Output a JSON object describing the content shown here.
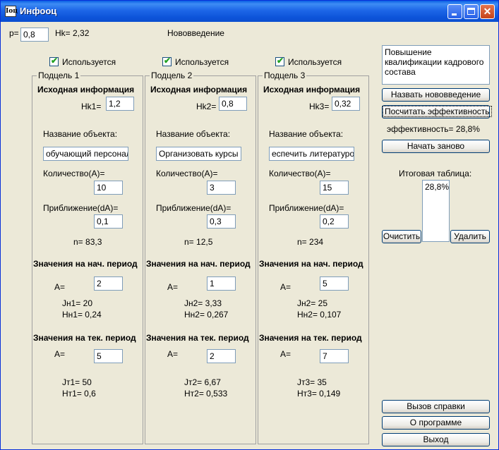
{
  "window": {
    "title": "Инфооц",
    "icon_text": "Iоц"
  },
  "header": {
    "p_label": "р=",
    "p_value": "0,8",
    "hk_text": "Hk= 2,32",
    "innovation_label": "Нововведение"
  },
  "groups": [
    {
      "used_label": "Используется",
      "caption": "Подцель 1",
      "source_header": "Исходная информация",
      "hk_label": "Hk1=",
      "hk_value": "1,2",
      "object_name_label": "Название объекта:",
      "object_name_value": "обучающий персонал",
      "quantity_label": "Количество(A)=",
      "quantity_value": "10",
      "approx_label": "Приближение(dA)=",
      "approx_value": "0,1",
      "n_text": "n= 83,3",
      "start_period_header": "Значения на нач. период",
      "start_a_label": "A=",
      "start_a_value": "2",
      "start_j_text": "Jн1= 20",
      "start_h_text": "Hн1= 0,24",
      "cur_period_header": "Значения на тек. период",
      "cur_a_label": "A=",
      "cur_a_value": "5",
      "cur_j_text": "Jт1= 50",
      "cur_h_text": "Hт1= 0,6"
    },
    {
      "used_label": "Используется",
      "caption": "Подцель 2",
      "source_header": "Исходная информация",
      "hk_label": "Hk2=",
      "hk_value": "0,8",
      "object_name_label": "Название объекта:",
      "object_name_value": "Организовать курсы",
      "quantity_label": "Количество(A)=",
      "quantity_value": "3",
      "approx_label": "Приближение(dA)=",
      "approx_value": "0,3",
      "n_text": "n= 12,5",
      "start_period_header": "Значения на нач. период",
      "start_a_label": "A=",
      "start_a_value": "1",
      "start_j_text": "Jн2= 3,33",
      "start_h_text": "Hн2= 0,267",
      "cur_period_header": "Значения на тек. период",
      "cur_a_label": "A=",
      "cur_a_value": "2",
      "cur_j_text": "Jт2= 6,67",
      "cur_h_text": "Hт2= 0,533"
    },
    {
      "used_label": "Используется",
      "caption": "Подцель 3",
      "source_header": "Исходная информация",
      "hk_label": "Hk3=",
      "hk_value": "0,32",
      "object_name_label": "Название объекта:",
      "object_name_value": "еспечить литературой",
      "quantity_label": "Количество(A)=",
      "quantity_value": "15",
      "approx_label": "Приближение(dA)=",
      "approx_value": "0,2",
      "n_text": "n= 234",
      "start_period_header": "Значения на нач. период",
      "start_a_label": "A=",
      "start_a_value": "5",
      "start_j_text": "Jн2= 25",
      "start_h_text": "Hн2= 0,107",
      "cur_period_header": "Значения на тек. период",
      "cur_a_label": "A=",
      "cur_a_value": "7",
      "cur_j_text": "Jт3= 35",
      "cur_h_text": "Hт3= 0,149"
    }
  ],
  "right": {
    "innovation_text": "Повышение квалификации кадрового состава",
    "name_button": "Назвать нововведение",
    "calc_button": "Посчитать эффективность",
    "efficiency_text": "эффективность= 28,8%",
    "restart_button": "Начать заново",
    "summary_label": "Итоговая таблица:",
    "summary_items": [
      "28,8%"
    ],
    "clear_button": "Очистить",
    "delete_button": "Удалить",
    "help_button": "Вызов справки",
    "about_button": "О программе",
    "exit_button": "Выход"
  },
  "colors": {
    "titlebar": "#0C53D9",
    "close_button": "#C6431A",
    "window_bg": "#ECE9D8",
    "check_mark": "#21A121"
  }
}
